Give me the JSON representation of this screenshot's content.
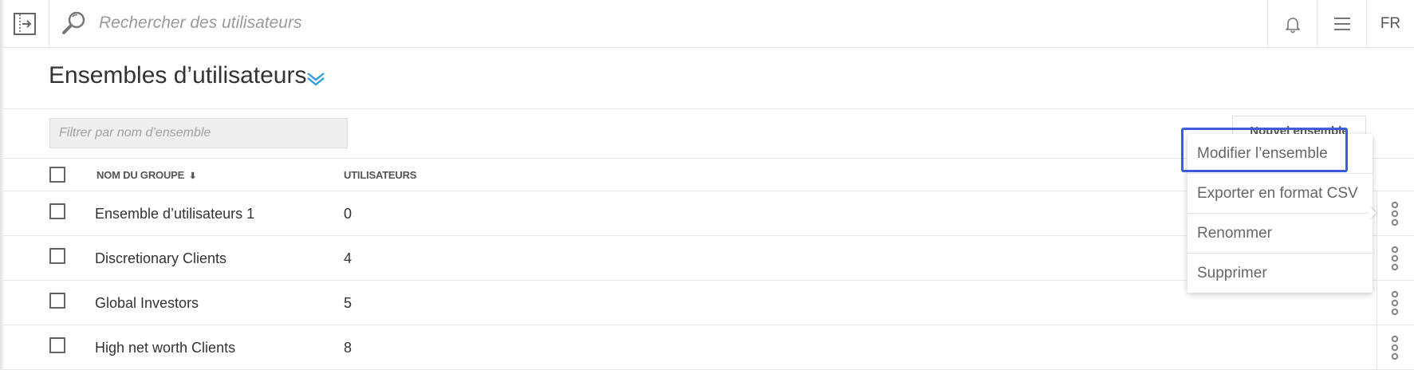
{
  "topbar": {
    "search_placeholder": "Rechercher des utilisateurs",
    "language": "FR",
    "icons": [
      "sidebar-toggle-icon",
      "search-icon",
      "bell-icon",
      "hamburger-menu-icon"
    ]
  },
  "page": {
    "title": "Ensembles d’utilisateurs",
    "filter_placeholder": "Filtrer par nom d’ensemble",
    "new_set_label": "Nouvel ensemble",
    "accent_color": "#2d9be0"
  },
  "table": {
    "columns": [
      "NOM DU GROUPE",
      "UTILISATEURS"
    ],
    "rows": [
      {
        "name": "Ensemble d’utilisateurs 1",
        "count": "0"
      },
      {
        "name": "Discretionary Clients",
        "count": "4"
      },
      {
        "name": "Global Investors",
        "count": "5"
      },
      {
        "name": "High net worth Clients",
        "count": "8"
      }
    ]
  },
  "context_menu": {
    "items": [
      "Modifier l’ensemble",
      "Exporter en format CSV",
      "Renommer",
      "Supprimer"
    ],
    "highlight_color": "#3d5be0"
  }
}
